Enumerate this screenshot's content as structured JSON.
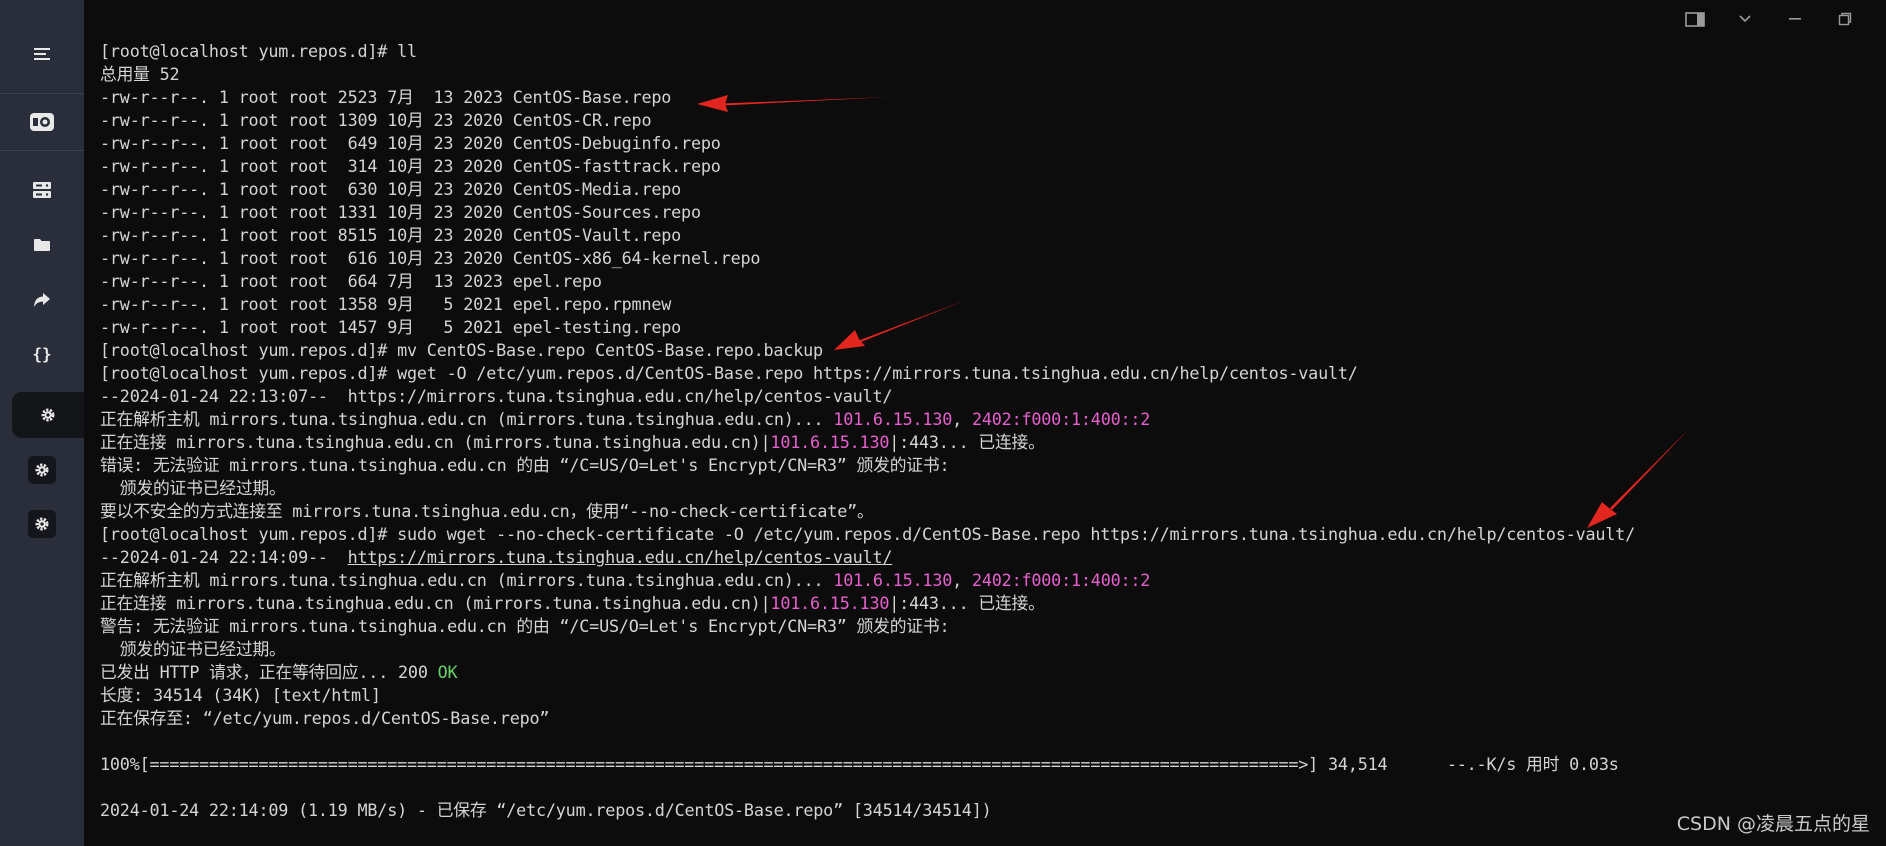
{
  "window": {
    "icons": [
      "sidebar-toggle-icon",
      "chevron-down-icon",
      "minimize-icon",
      "restore-icon"
    ]
  },
  "sidebar": {
    "items": [
      {
        "name": "menu",
        "icon": "hamburger-icon"
      },
      {
        "name": "logo",
        "icon": "app-logo-icon"
      },
      {
        "name": "servers",
        "icon": "server-icon"
      },
      {
        "name": "files",
        "icon": "folder-icon"
      },
      {
        "name": "forward",
        "icon": "forward-icon"
      },
      {
        "name": "code",
        "icon": "braces-icon"
      },
      {
        "name": "settings-active",
        "icon": "gear-icon"
      },
      {
        "name": "settings-2",
        "icon": "gear-icon"
      },
      {
        "name": "settings-3",
        "icon": "gear-icon"
      }
    ]
  },
  "terminal": {
    "lines": [
      "[root@localhost yum.repos.d]# ll",
      "总用量 52",
      "-rw-r--r--. 1 root root 2523 7月  13 2023 CentOS-Base.repo",
      "-rw-r--r--. 1 root root 1309 10月 23 2020 CentOS-CR.repo",
      "-rw-r--r--. 1 root root  649 10月 23 2020 CentOS-Debuginfo.repo",
      "-rw-r--r--. 1 root root  314 10月 23 2020 CentOS-fasttrack.repo",
      "-rw-r--r--. 1 root root  630 10月 23 2020 CentOS-Media.repo",
      "-rw-r--r--. 1 root root 1331 10月 23 2020 CentOS-Sources.repo",
      "-rw-r--r--. 1 root root 8515 10月 23 2020 CentOS-Vault.repo",
      "-rw-r--r--. 1 root root  616 10月 23 2020 CentOS-x86_64-kernel.repo",
      "-rw-r--r--. 1 root root  664 7月  13 2023 epel.repo",
      "-rw-r--r--. 1 root root 1358 9月   5 2021 epel.repo.rpmnew",
      "-rw-r--r--. 1 root root 1457 9月   5 2021 epel-testing.repo",
      "[root@localhost yum.repos.d]# mv CentOS-Base.repo CentOS-Base.repo.backup",
      "[root@localhost yum.repos.d]# wget -O /etc/yum.repos.d/CentOS-Base.repo https://mirrors.tuna.tsinghua.edu.cn/help/centos-vault/",
      "--2024-01-24 22:13:07--  https://mirrors.tuna.tsinghua.edu.cn/help/centos-vault/"
    ],
    "resolve1": {
      "prefix": "正在解析主机 mirrors.tuna.tsinghua.edu.cn (mirrors.tuna.tsinghua.edu.cn)... ",
      "ip4": "101.6.15.130",
      "sep": ", ",
      "ip6": "2402:f000:1:400::2"
    },
    "connect1": {
      "prefix": "正在连接 mirrors.tuna.tsinghua.edu.cn (mirrors.tuna.tsinghua.edu.cn)|",
      "ip4": "101.6.15.130",
      "suffix": "|:443... 已连接。"
    },
    "lines2": [
      "错误: 无法验证 mirrors.tuna.tsinghua.edu.cn 的由 “/C=US/O=Let's Encrypt/CN=R3” 颁发的证书:",
      "  颁发的证书已经过期。",
      "要以不安全的方式连接至 mirrors.tuna.tsinghua.edu.cn，使用“--no-check-certificate”。",
      "[root@localhost yum.repos.d]# sudo wget --no-check-certificate -O /etc/yum.repos.d/CentOS-Base.repo https://mirrors.tuna.tsinghua.edu.cn/help/centos-vault/"
    ],
    "date2_prefix": "--2024-01-24 22:14:09--  ",
    "date2_url": "https://mirrors.tuna.tsinghua.edu.cn/help/centos-vault/",
    "resolve2": {
      "prefix": "正在解析主机 mirrors.tuna.tsinghua.edu.cn (mirrors.tuna.tsinghua.edu.cn)... ",
      "ip4": "101.6.15.130",
      "sep": ", ",
      "ip6": "2402:f000:1:400::2"
    },
    "connect2": {
      "prefix": "正在连接 mirrors.tuna.tsinghua.edu.cn (mirrors.tuna.tsinghua.edu.cn)|",
      "ip4": "101.6.15.130",
      "suffix": "|:443... 已连接。"
    },
    "lines3": [
      "警告: 无法验证 mirrors.tuna.tsinghua.edu.cn 的由 “/C=US/O=Let's Encrypt/CN=R3” 颁发的证书:",
      "  颁发的证书已经过期。"
    ],
    "http_prefix": "已发出 HTTP 请求，正在等待回应... 200 ",
    "http_ok": "OK",
    "lines4": [
      "长度: 34514 (34K) [text/html]",
      "正在保存至: “/etc/yum.repos.d/CentOS-Base.repo”",
      "",
      "100%[====================================================================================================================>] 34,514      --.-K/s 用时 0.03s",
      "",
      "2024-01-24 22:14:09 (1.19 MB/s) - 已保存 “/etc/yum.repos.d/CentOS-Base.repo” [34514/34514])"
    ]
  },
  "watermark": "CSDN @凌晨五点的星",
  "colors": {
    "background": "#0c0c0c",
    "sidebar": "#2a2d3a",
    "text": "#d4d4d4",
    "ip_highlight": "#e85fcf",
    "ok_green": "#69d36b",
    "annotation_arrow": "#e3261f"
  }
}
